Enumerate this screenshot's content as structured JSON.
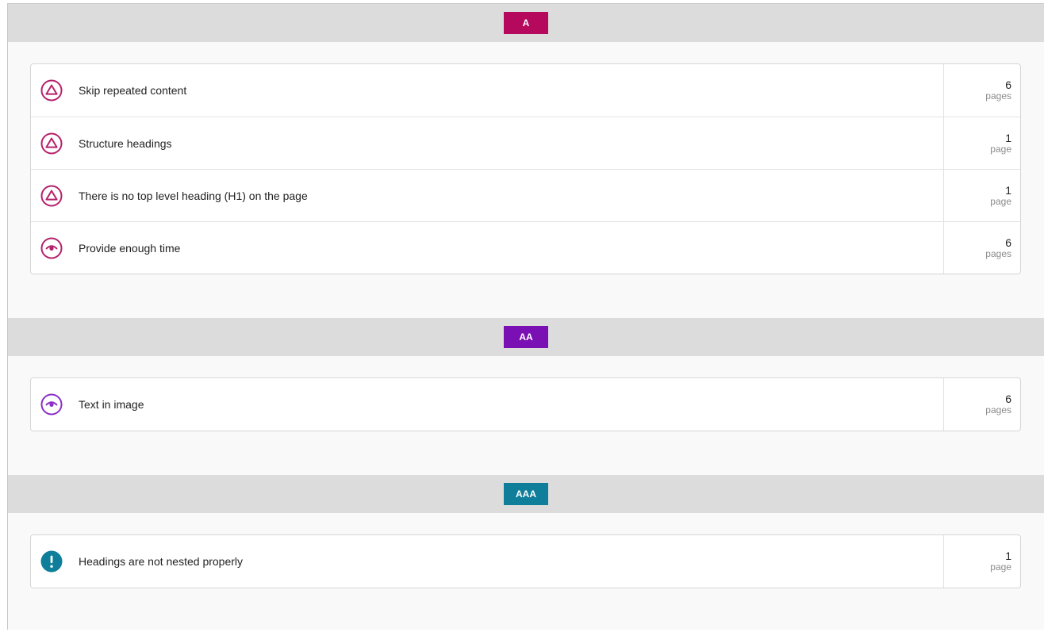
{
  "colors": {
    "level_a": "#b5095e",
    "level_aa": "#7a10b3",
    "level_aaa": "#0f7e9b",
    "icon_a": "#b5206b",
    "icon_aa": "#8b2fc6",
    "icon_aaa": "#0f7e9b"
  },
  "levels": [
    {
      "label": "A",
      "issues": [
        {
          "icon": "warning-triangle-icon",
          "title": "Skip repeated content",
          "count": "6",
          "unit": "pages"
        },
        {
          "icon": "warning-triangle-icon",
          "title": "Structure headings",
          "count": "1",
          "unit": "page"
        },
        {
          "icon": "warning-triangle-icon",
          "title": "There is no top level heading (H1) on the page",
          "count": "1",
          "unit": "page"
        },
        {
          "icon": "eye-icon",
          "title": "Provide enough time",
          "count": "6",
          "unit": "pages"
        }
      ]
    },
    {
      "label": "AA",
      "issues": [
        {
          "icon": "eye-icon",
          "title": "Text in image",
          "count": "6",
          "unit": "pages"
        }
      ]
    },
    {
      "label": "AAA",
      "issues": [
        {
          "icon": "exclamation-circle-icon",
          "title": "Headings are not nested properly",
          "count": "1",
          "unit": "page"
        }
      ]
    }
  ]
}
